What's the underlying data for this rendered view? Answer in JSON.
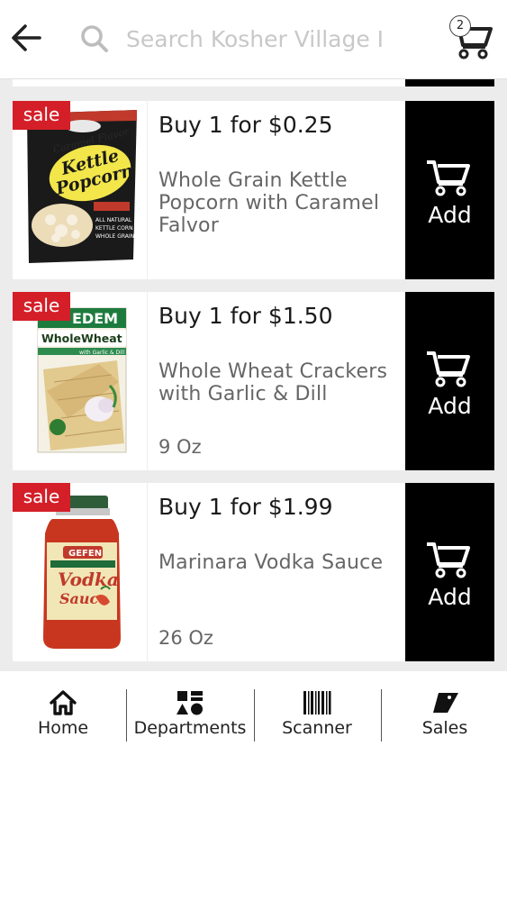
{
  "header": {
    "search_placeholder": "Search Kosher Village I",
    "cart_count": "2"
  },
  "products": [
    {
      "badge": "sale",
      "price": "Buy 1 for $0.25",
      "name": "Whole Grain Kettle Popcorn with Caramel Falvor",
      "size": "",
      "add_label": "Add",
      "package_text": [
        "Caramel Flavor",
        "Kettle Popcorn",
        "ALL NATURAL",
        "KETTLE CORN",
        "WHOLE GRAIN"
      ]
    },
    {
      "badge": "sale",
      "price": "Buy 1 for $1.50",
      "name": "Whole Wheat Crackers with Garlic & Dill",
      "size": "9 Oz",
      "add_label": "Add",
      "package_text": [
        "EDEM",
        "WholeWheat",
        "with Garlic & Dill"
      ]
    },
    {
      "badge": "sale",
      "price": "Buy 1 for $1.99",
      "name": "Marinara Vodka Sauce",
      "size": "26 Oz",
      "add_label": "Add",
      "package_text": [
        "GEFEN",
        "Vodka",
        "Sauce"
      ]
    }
  ],
  "nav": {
    "home": "Home",
    "departments": "Departments",
    "scanner": "Scanner",
    "sales": "Sales"
  },
  "colors": {
    "sale_badge": "#d41f29",
    "add_button": "#000000",
    "list_background": "#ececec"
  },
  "icons": {
    "back": "back-arrow-icon",
    "search": "search-icon",
    "cart": "cart-icon",
    "add_cart": "add-to-cart-icon",
    "home": "home-icon",
    "departments": "departments-shapes-icon",
    "scanner": "barcode-icon",
    "sales": "sale-tag-icon"
  }
}
